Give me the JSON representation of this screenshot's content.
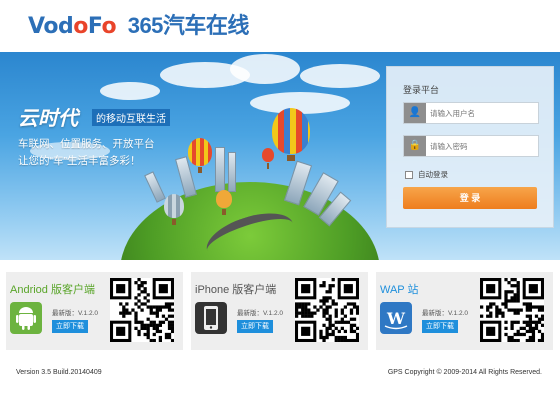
{
  "header": {
    "brand_part1": "Vo",
    "brand_part2": "d",
    "brand_part3": "o",
    "brand_part4": "F",
    "brand_part5": "o",
    "brand_number": "365",
    "brand_cn": "汽车在线"
  },
  "banner": {
    "slogan_big": "云时代",
    "slogan_sub": "的移动互联生活",
    "line1": "车联网、位置服务、开放平台",
    "line2": "让您的“车”生活丰富多彩！"
  },
  "login": {
    "title": "登录平台",
    "username_placeholder": "请输入用户名",
    "password_placeholder": "请输入密码",
    "auto_login": "自动登录",
    "submit": "登 录"
  },
  "cards": [
    {
      "title": "Andriod 版客户端",
      "title_color": "#5aa52a",
      "icon": "android-icon",
      "version": "最新版：V.1.2.0",
      "download": "立即下载"
    },
    {
      "title": "iPhone 版客户端",
      "title_color": "#555555",
      "icon": "iphone-icon",
      "version": "最新版：V.1.2.0",
      "download": "立即下载"
    },
    {
      "title": "WAP 站",
      "title_color": "#1e8fdc",
      "icon": "wap-icon",
      "version": "最新版：V.1.2.0",
      "download": "立即下载"
    }
  ],
  "footer": {
    "version": "Version 3.5 Build.20140409",
    "copyright": "GPS Copyright © 2009-2014 All Rights Reserved."
  },
  "colors": {
    "brand_blue": "#2c6fb7",
    "brand_red": "#e9442a",
    "accent_orange": "#ee7d1e",
    "download_blue": "#1e8fdc"
  }
}
